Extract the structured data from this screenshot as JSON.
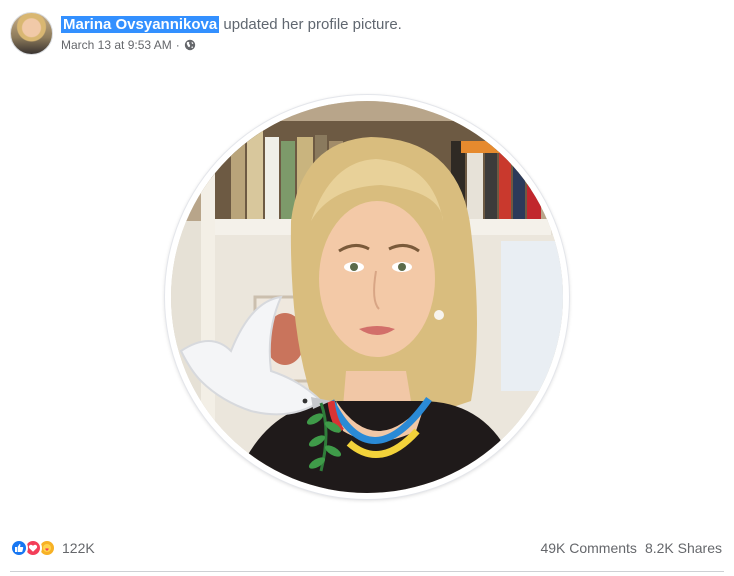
{
  "post": {
    "author": "Marina Ovsyannikova",
    "action": "updated her profile picture.",
    "timestamp": "March 13 at 9:53 AM",
    "separator": "·",
    "privacy_icon": "globe-icon"
  },
  "reactions": {
    "icons": [
      "like-icon",
      "love-icon",
      "care-icon"
    ],
    "count": "122K"
  },
  "stats": {
    "comments": "49K Comments",
    "shares": "8.2K Shares"
  },
  "colors": {
    "author_highlight": "#3390ff",
    "like": "#1877f2",
    "love": "#f33e58",
    "care": "#f7b125",
    "meta_text": "#65676b"
  }
}
